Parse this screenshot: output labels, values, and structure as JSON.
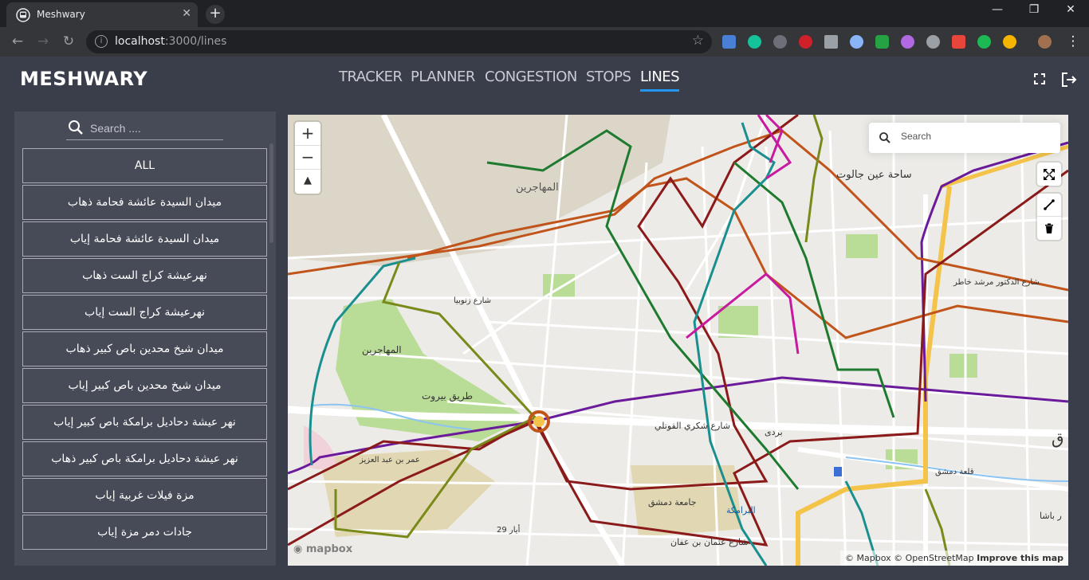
{
  "browser": {
    "tab_title": "Meshwary",
    "tab_close": "✕",
    "new_tab": "+",
    "url_host": "localhost",
    "url_path": ":3000/lines",
    "window_controls": [
      "—",
      "❐",
      "✕"
    ]
  },
  "app": {
    "brand": "MESHWARY",
    "nav": [
      {
        "label": "TRACKER",
        "active": false
      },
      {
        "label": "PLANNER",
        "active": false
      },
      {
        "label": "CONGESTION",
        "active": false
      },
      {
        "label": "STOPS",
        "active": false
      },
      {
        "label": "LINES",
        "active": true
      }
    ],
    "accent_color": "#2196f3"
  },
  "sidebar": {
    "search_placeholder": "Search ....",
    "lines": [
      "ALL",
      "ميدان السيدة عائشة فحامة ذهاب",
      "ميدان السيدة عائشة فحامة إياب",
      "نهرعيشة كراج الست ذهاب",
      "نهرعيشة كراج الست إياب",
      "ميدان شيخ محدين باص كبير ذهاب",
      "ميدان شيخ محدين باص كبير إياب",
      "نهر عيشة دحاديل برامكة باص كبير إياب",
      "نهر عيشة دحاديل برامكة باص كبير ذهاب",
      "مزة فيلات غربية إياب",
      "جادات دمر مزة إياب"
    ]
  },
  "map": {
    "search_placeholder": "Search",
    "zoom_in": "+",
    "zoom_out": "−",
    "compass": "▲",
    "logo": "mapbox",
    "attribution_1": "© Mapbox © OpenStreetMap",
    "attribution_2": "Improve this map",
    "labels": {
      "muhajirin_1": "المهاجرين",
      "muhajirin_2": "المهاجرين",
      "sahat_ain_jalut": "ساحة عين جالوت",
      "tariq_beirut": "طريق بيروت",
      "shukri_quwatli": "شارع شكري القوتلي",
      "barada": "بردى",
      "jamiat_dimashq": "جامعة دمشق",
      "baramkeh": "البرامكة",
      "qalaat_dimashq": "قلعة دمشق",
      "umar_abdulaziz": "عمر بن عبد العزيز",
      "uthman_affan": "شارع عثمان بن عفان",
      "zanubia": "شارع زنوبيا",
      "khater": "شارع الدكتور مرشد خاطر",
      "ayyar": "29 أيار",
      "pasha": "ر باشا",
      "shimal": "ق"
    },
    "route_colors": {
      "dark_red": "#8b1a1a",
      "orange": "#c0541a",
      "green": "#1e7a2e",
      "teal": "#1a8f8f",
      "purple": "#6a1a9a",
      "olive": "#7a8a1a",
      "magenta": "#c81aa0",
      "yellow_road": "#f4c34a"
    }
  }
}
